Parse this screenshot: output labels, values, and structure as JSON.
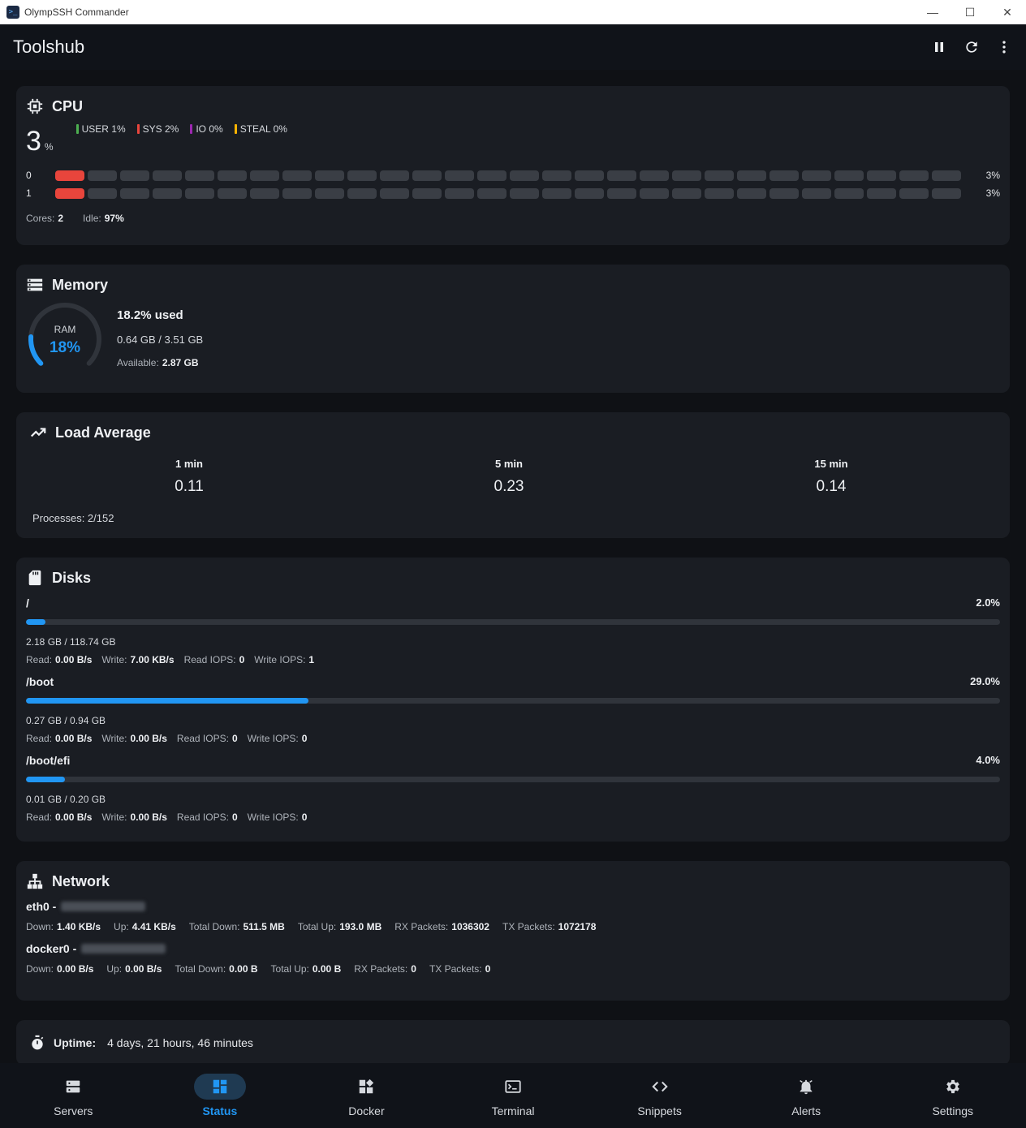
{
  "window": {
    "title": "OlympSSH Commander"
  },
  "header": {
    "title": "Toolshub"
  },
  "cpu": {
    "title": "CPU",
    "total": "3",
    "unit": "%",
    "legend": [
      {
        "label": "USER 1%",
        "color": "#4caf50"
      },
      {
        "label": "SYS 2%",
        "color": "#e8453c"
      },
      {
        "label": "IO 0%",
        "color": "#9c27b0"
      },
      {
        "label": "STEAL 0%",
        "color": "#ffb300"
      }
    ],
    "cores": [
      {
        "index": "0",
        "value": "3%",
        "filled_segments": 1
      },
      {
        "index": "1",
        "value": "3%",
        "filled_segments": 1
      }
    ],
    "segments_per_core": 28,
    "cores_label": "Cores:",
    "cores_value": "2",
    "idle_label": "Idle:",
    "idle_value": "97%"
  },
  "memory": {
    "title": "Memory",
    "gauge_label": "RAM",
    "gauge_value": "18%",
    "gauge_fraction": 0.182,
    "used": "18.2% used",
    "size": "0.64 GB / 3.51 GB",
    "available_label": "Available:",
    "available_value": "2.87 GB"
  },
  "load": {
    "title": "Load Average",
    "cols": [
      {
        "label": "1 min",
        "value": "0.11"
      },
      {
        "label": "5 min",
        "value": "0.23"
      },
      {
        "label": "15 min",
        "value": "0.14"
      }
    ],
    "processes": "Processes: 2/152"
  },
  "disks": {
    "title": "Disks",
    "items": [
      {
        "mount": "/",
        "percent": "2.0%",
        "fraction": 0.02,
        "size": "2.18 GB / 118.74 GB",
        "stats": [
          [
            "Read:",
            "0.00 B/s"
          ],
          [
            "Write:",
            "7.00 KB/s"
          ],
          [
            "Read IOPS:",
            "0"
          ],
          [
            "Write IOPS:",
            "1"
          ]
        ]
      },
      {
        "mount": "/boot",
        "percent": "29.0%",
        "fraction": 0.29,
        "size": "0.27 GB / 0.94 GB",
        "stats": [
          [
            "Read:",
            "0.00 B/s"
          ],
          [
            "Write:",
            "0.00 B/s"
          ],
          [
            "Read IOPS:",
            "0"
          ],
          [
            "Write IOPS:",
            "0"
          ]
        ]
      },
      {
        "mount": "/boot/efi",
        "percent": "4.0%",
        "fraction": 0.04,
        "size": "0.01 GB / 0.20 GB",
        "stats": [
          [
            "Read:",
            "0.00 B/s"
          ],
          [
            "Write:",
            "0.00 B/s"
          ],
          [
            "Read IOPS:",
            "0"
          ],
          [
            "Write IOPS:",
            "0"
          ]
        ]
      }
    ]
  },
  "network": {
    "title": "Network",
    "interfaces": [
      {
        "name": "eth0 -",
        "stats": [
          [
            "Down:",
            "1.40 KB/s"
          ],
          [
            "Up:",
            "4.41 KB/s"
          ],
          [
            "Total Down:",
            "511.5 MB"
          ],
          [
            "Total Up:",
            "193.0 MB"
          ],
          [
            "RX Packets:",
            "1036302"
          ],
          [
            "TX Packets:",
            "1072178"
          ]
        ]
      },
      {
        "name": "docker0 -",
        "stats": [
          [
            "Down:",
            "0.00 B/s"
          ],
          [
            "Up:",
            "0.00 B/s"
          ],
          [
            "Total Down:",
            "0.00 B"
          ],
          [
            "Total Up:",
            "0.00 B"
          ],
          [
            "RX Packets:",
            "0"
          ],
          [
            "TX Packets:",
            "0"
          ]
        ]
      }
    ]
  },
  "uptime": {
    "label": "Uptime:",
    "value": "4 days, 21 hours, 46 minutes"
  },
  "nav": [
    {
      "label": "Servers",
      "icon": "servers-icon",
      "active": false
    },
    {
      "label": "Status",
      "icon": "dashboard-icon",
      "active": true
    },
    {
      "label": "Docker",
      "icon": "docker-icon",
      "active": false
    },
    {
      "label": "Terminal",
      "icon": "terminal-icon",
      "active": false
    },
    {
      "label": "Snippets",
      "icon": "code-icon",
      "active": false
    },
    {
      "label": "Alerts",
      "icon": "bell-icon",
      "active": false
    },
    {
      "label": "Settings",
      "icon": "gear-icon",
      "active": false
    }
  ],
  "colors": {
    "accent": "#2196f3",
    "danger": "#e8453c",
    "card": "#1a1d23",
    "bg": "#0f1115"
  }
}
